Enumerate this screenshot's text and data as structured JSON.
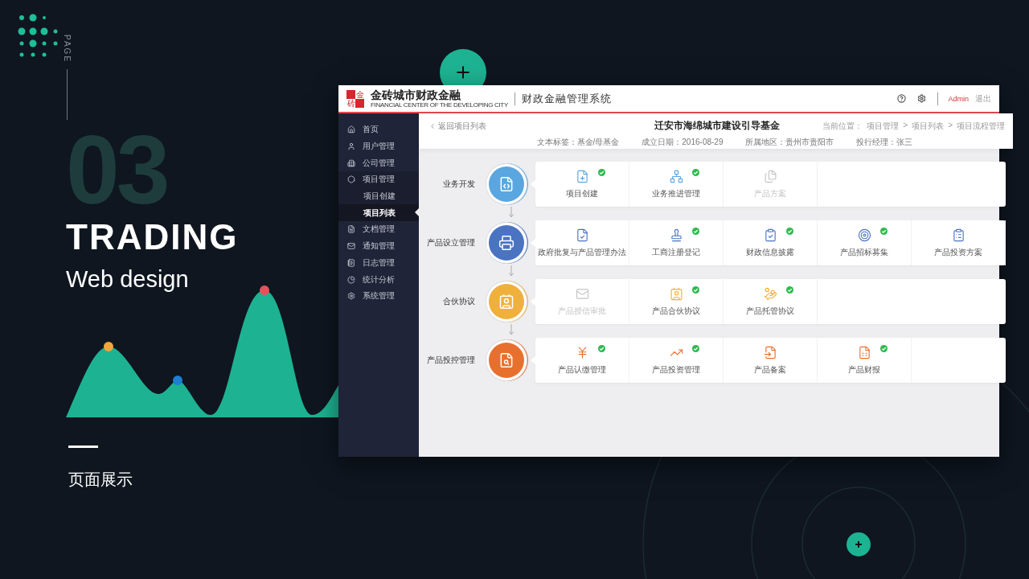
{
  "slide": {
    "page_label": "PAGE",
    "number": "03",
    "title": "TRADING",
    "subtitle": "Web design",
    "caption": "页面展示"
  },
  "app": {
    "logo": {
      "mark": [
        "金",
        "砖"
      ],
      "name": "金砖城市财政金融",
      "tagline": "FINANCIAL CENTER OF THE DEVELOPING CITY"
    },
    "system_title": "财政金融管理系统",
    "user": "Admin",
    "logout": "退出",
    "sidebar": {
      "items": [
        {
          "label": "首页",
          "selected": false
        },
        {
          "label": "用户管理",
          "selected": false
        },
        {
          "label": "公司管理",
          "selected": false
        },
        {
          "label": "项目管理",
          "selected": false,
          "expanded": true,
          "children": [
            {
              "label": "项目创建",
              "selected": false
            },
            {
              "label": "项目列表",
              "selected": true
            }
          ]
        },
        {
          "label": "文档管理",
          "selected": false
        },
        {
          "label": "通知管理",
          "selected": false
        },
        {
          "label": "日志管理",
          "selected": false
        },
        {
          "label": "统计分析",
          "selected": false
        },
        {
          "label": "系统管理",
          "selected": false
        }
      ]
    },
    "header": {
      "back": "返回项目列表",
      "title": "迁安市海绵城市建设引导基金",
      "breadcrumb": [
        "当前位置：",
        "项目管理",
        ">",
        "项目列表",
        ">",
        "项目流程管理"
      ],
      "meta": [
        "文本标签：基金/母基金",
        "成立日期：2016-08-29",
        "所属地区：贵州市贵阳市",
        "投行经理：张三"
      ]
    },
    "stages": [
      {
        "label": "业务开发",
        "color": "#5aa6e0",
        "tasks": [
          {
            "label": "项目创建",
            "done": true,
            "disabled": false
          },
          {
            "label": "业务推进管理",
            "done": true,
            "disabled": false
          },
          {
            "label": "产品方案",
            "done": false,
            "disabled": true
          }
        ]
      },
      {
        "label": "产品设立管理",
        "color": "#4a73c2",
        "tasks": [
          {
            "label": "政府批复与产品管理办法",
            "done": false,
            "disabled": false
          },
          {
            "label": "工商注册登记",
            "done": true,
            "disabled": false
          },
          {
            "label": "财政信息披露",
            "done": true,
            "disabled": false
          },
          {
            "label": "产品招标募集",
            "done": true,
            "disabled": false
          },
          {
            "label": "产品投资方案",
            "done": false,
            "disabled": false
          }
        ]
      },
      {
        "label": "合伙协议",
        "color": "#f0b03c",
        "tasks": [
          {
            "label": "产品授信审批",
            "done": false,
            "disabled": true
          },
          {
            "label": "产品合伙协议",
            "done": true,
            "disabled": false
          },
          {
            "label": "产品托管协议",
            "done": true,
            "disabled": false
          }
        ]
      },
      {
        "label": "产品投控管理",
        "color": "#e8702f",
        "tasks": [
          {
            "label": "产品认缴管理",
            "done": true,
            "disabled": false
          },
          {
            "label": "产品投资管理",
            "done": true,
            "disabled": false
          },
          {
            "label": "产品备案",
            "done": false,
            "disabled": false
          },
          {
            "label": "产品财报",
            "done": true,
            "disabled": false
          }
        ]
      }
    ]
  }
}
